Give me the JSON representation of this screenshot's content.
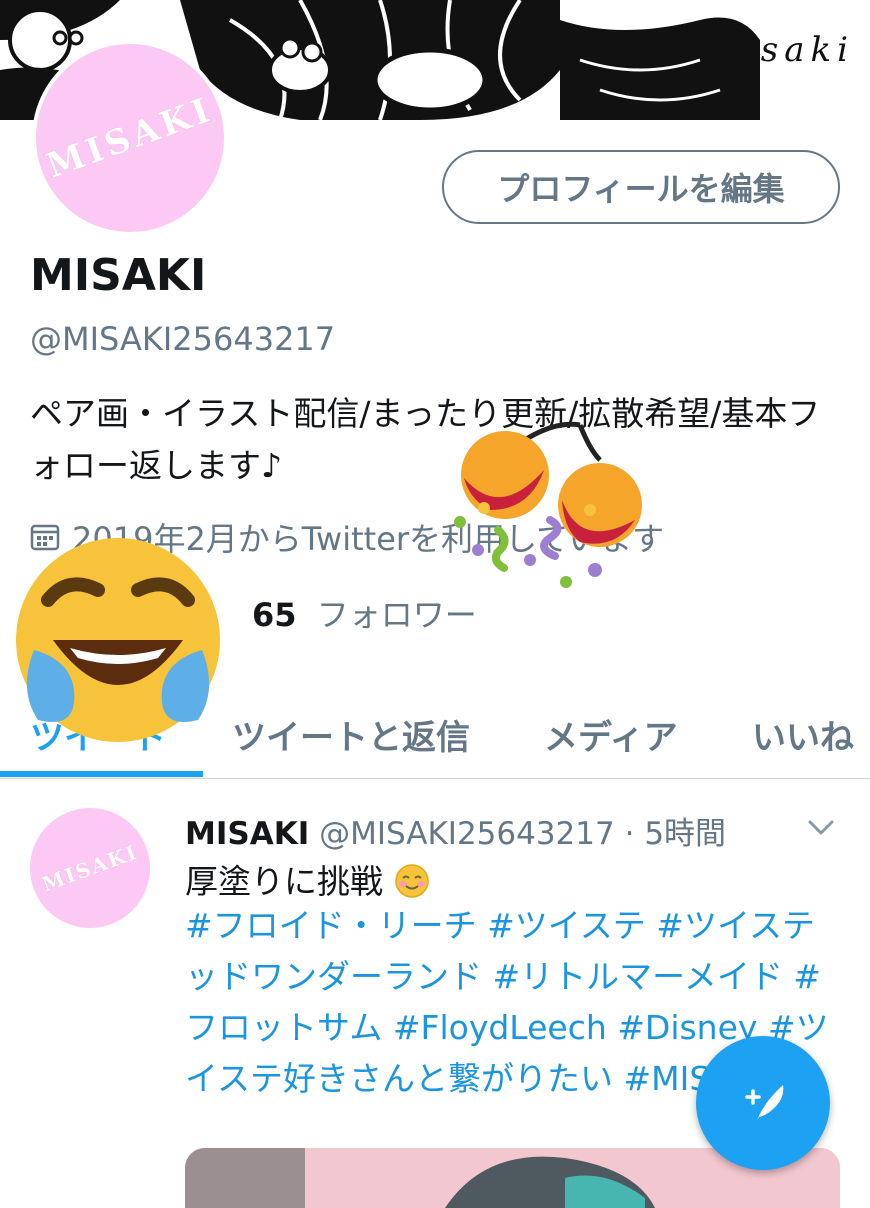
{
  "header": {
    "signature": "Misaki"
  },
  "profile": {
    "avatar_text": "MISAKI",
    "edit_button": "プロフィールを編集",
    "name": "MISAKI",
    "handle": "@MISAKI25643217",
    "bio": "ペア画・イラスト配信/まったり更新/拡散希望/基本フォロー返します♪",
    "joined": "2019年2月からTwitterを利用しています",
    "following_label": "ー",
    "followers_count": "65",
    "followers_label": "フォロワー"
  },
  "tabs": [
    {
      "label": "ツイート"
    },
    {
      "label": "ツイートと返信"
    },
    {
      "label": "メディア"
    },
    {
      "label": "いいね"
    }
  ],
  "tweet": {
    "avatar_text": "MISAKI",
    "name": "MISAKI",
    "handle": "@MISAKI25643217",
    "separator": "·",
    "time": "5時間",
    "text": "厚塗りに挑戦",
    "text_emoji": "smiling-face-icon",
    "hashtags": "#フロイド・リーチ #ツイステ #ツイステッドワンダーランド #リトルマーメイド #フロットサム #FloydLeech #Disney #ツイステ好きさんと繋がりたい #MISAKI"
  },
  "colors": {
    "accent": "#1da1f2",
    "link": "#1b95e0",
    "muted": "#657786",
    "avatar_pink": "#fbc9f3"
  },
  "icons": {
    "calendar": "calendar-icon",
    "compose": "compose-tweet-icon",
    "chevron": "chevron-down-icon",
    "laugh": "tears-of-joy-emoji",
    "party": "party-popper-emoji"
  }
}
